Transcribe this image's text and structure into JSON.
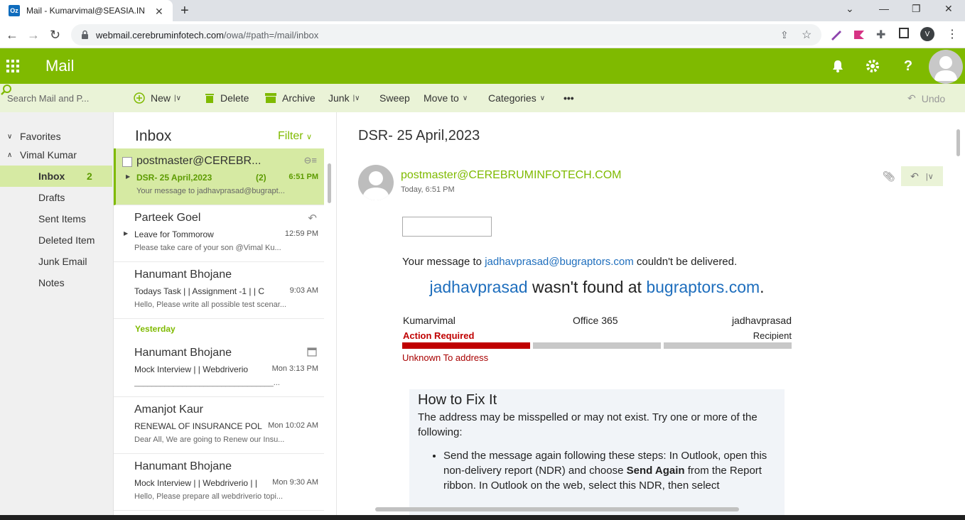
{
  "browser": {
    "tab_title": "Mail - Kumarvimal@SEASIA.IN",
    "tab_icon_text": "Oz",
    "url_host": "webmail.cerebruminfotech.com",
    "url_path": "/owa/#path=/mail/inbox",
    "profile_initial": "V"
  },
  "header": {
    "app_name": "Mail",
    "brand_color": "#7fba00"
  },
  "search": {
    "placeholder": "Search Mail and P..."
  },
  "toolbar": {
    "new_label": "New",
    "delete_label": "Delete",
    "archive_label": "Archive",
    "junk_label": "Junk",
    "sweep_label": "Sweep",
    "move_label": "Move to",
    "categories_label": "Categories",
    "more_label": "•••",
    "undo_label": "Undo"
  },
  "folders": {
    "favorites": "Favorites",
    "account": "Vimal Kumar",
    "items": [
      {
        "label": "Inbox",
        "count": "2"
      },
      {
        "label": "Drafts"
      },
      {
        "label": "Sent Items"
      },
      {
        "label": "Deleted Item"
      },
      {
        "label": "Junk Email"
      },
      {
        "label": "Notes"
      }
    ]
  },
  "list": {
    "title": "Inbox",
    "filter": "Filter",
    "yesterday": "Yesterday",
    "messages": [
      {
        "from": "postmaster@CEREBR...",
        "subject": "DSR- 25 April,2023",
        "count": "(2)",
        "time": "6:51 PM",
        "preview": "Your message to jadhavprasad@bugrapt..."
      },
      {
        "from": "Parteek Goel",
        "subject": "Leave for Tommorow",
        "time": "12:59 PM",
        "preview": "Please take care of your son @Vimal Ku..."
      },
      {
        "from": "Hanumant Bhojane",
        "subject": "Todays Task | | Assignment -1 | | C",
        "time": "9:03 AM",
        "preview": "Hello, Please write all possible test scenar..."
      },
      {
        "from": "Hanumant Bhojane",
        "subject": "Mock Interview | | Webdriverio",
        "time": "Mon 3:13 PM",
        "preview": "________________________________..."
      },
      {
        "from": "Amanjot Kaur",
        "subject": "RENEWAL OF INSURANCE POLICY",
        "time": "Mon 10:02 AM",
        "preview": "Dear All, We are going to Renew our Insu..."
      },
      {
        "from": "Hanumant Bhojane",
        "subject": "Mock Interview | | Webdriverio | |",
        "time": "Mon 9:30 AM",
        "preview": "Hello, Please prepare all webdriverio topi..."
      }
    ]
  },
  "reading": {
    "subject": "DSR- 25 April,2023",
    "from": "postmaster@CEREBRUMINFOTECH.COM",
    "date": "Today, 6:51 PM",
    "line1_pre": "Your message to ",
    "line1_link": "jadhavprasad@bugraptors.com",
    "line1_post": " couldn't be delivered.",
    "line2_user": "jadhavprasad",
    "line2_mid": " wasn't found at ",
    "line2_domain": "bugraptors.com",
    "line2_end": ".",
    "col_sender": "Kumarvimal",
    "col_service": "Office 365",
    "col_recipient": "jadhavprasad",
    "action_required": "Action Required",
    "recipient_label": "Recipient",
    "unknown": "Unknown To address",
    "fix_title": "How to Fix It",
    "fix_text": "The address may be misspelled or may not exist. Try one or more of the following:",
    "fix_step_pre": "Send the message again following these steps: In Outlook, open this non-delivery report (NDR) and choose ",
    "fix_step_bold": "Send Again",
    "fix_step_post": " from the Report ribbon. In Outlook on the web, select this NDR, then select"
  }
}
